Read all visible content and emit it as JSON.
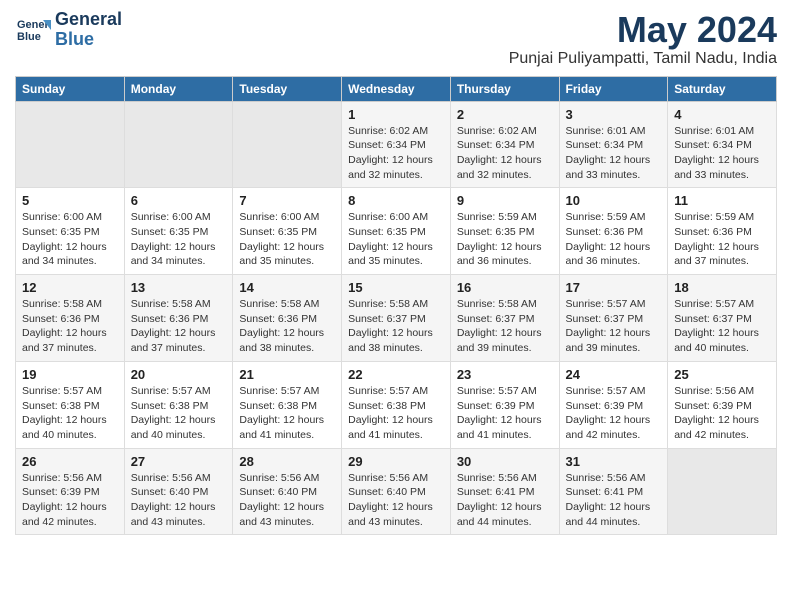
{
  "header": {
    "logo_line1": "General",
    "logo_line2": "Blue",
    "title": "May 2024",
    "subtitle": "Punjai Puliyampatti, Tamil Nadu, India"
  },
  "weekdays": [
    "Sunday",
    "Monday",
    "Tuesday",
    "Wednesday",
    "Thursday",
    "Friday",
    "Saturday"
  ],
  "weeks": [
    [
      {
        "day": "",
        "empty": true
      },
      {
        "day": "",
        "empty": true
      },
      {
        "day": "",
        "empty": true
      },
      {
        "day": "1",
        "sunrise": "6:02 AM",
        "sunset": "6:34 PM",
        "daylight": "12 hours and 32 minutes."
      },
      {
        "day": "2",
        "sunrise": "6:02 AM",
        "sunset": "6:34 PM",
        "daylight": "12 hours and 32 minutes."
      },
      {
        "day": "3",
        "sunrise": "6:01 AM",
        "sunset": "6:34 PM",
        "daylight": "12 hours and 33 minutes."
      },
      {
        "day": "4",
        "sunrise": "6:01 AM",
        "sunset": "6:34 PM",
        "daylight": "12 hours and 33 minutes."
      }
    ],
    [
      {
        "day": "5",
        "sunrise": "6:00 AM",
        "sunset": "6:35 PM",
        "daylight": "12 hours and 34 minutes."
      },
      {
        "day": "6",
        "sunrise": "6:00 AM",
        "sunset": "6:35 PM",
        "daylight": "12 hours and 34 minutes."
      },
      {
        "day": "7",
        "sunrise": "6:00 AM",
        "sunset": "6:35 PM",
        "daylight": "12 hours and 35 minutes."
      },
      {
        "day": "8",
        "sunrise": "6:00 AM",
        "sunset": "6:35 PM",
        "daylight": "12 hours and 35 minutes."
      },
      {
        "day": "9",
        "sunrise": "5:59 AM",
        "sunset": "6:35 PM",
        "daylight": "12 hours and 36 minutes."
      },
      {
        "day": "10",
        "sunrise": "5:59 AM",
        "sunset": "6:36 PM",
        "daylight": "12 hours and 36 minutes."
      },
      {
        "day": "11",
        "sunrise": "5:59 AM",
        "sunset": "6:36 PM",
        "daylight": "12 hours and 37 minutes."
      }
    ],
    [
      {
        "day": "12",
        "sunrise": "5:58 AM",
        "sunset": "6:36 PM",
        "daylight": "12 hours and 37 minutes."
      },
      {
        "day": "13",
        "sunrise": "5:58 AM",
        "sunset": "6:36 PM",
        "daylight": "12 hours and 37 minutes."
      },
      {
        "day": "14",
        "sunrise": "5:58 AM",
        "sunset": "6:36 PM",
        "daylight": "12 hours and 38 minutes."
      },
      {
        "day": "15",
        "sunrise": "5:58 AM",
        "sunset": "6:37 PM",
        "daylight": "12 hours and 38 minutes."
      },
      {
        "day": "16",
        "sunrise": "5:58 AM",
        "sunset": "6:37 PM",
        "daylight": "12 hours and 39 minutes."
      },
      {
        "day": "17",
        "sunrise": "5:57 AM",
        "sunset": "6:37 PM",
        "daylight": "12 hours and 39 minutes."
      },
      {
        "day": "18",
        "sunrise": "5:57 AM",
        "sunset": "6:37 PM",
        "daylight": "12 hours and 40 minutes."
      }
    ],
    [
      {
        "day": "19",
        "sunrise": "5:57 AM",
        "sunset": "6:38 PM",
        "daylight": "12 hours and 40 minutes."
      },
      {
        "day": "20",
        "sunrise": "5:57 AM",
        "sunset": "6:38 PM",
        "daylight": "12 hours and 40 minutes."
      },
      {
        "day": "21",
        "sunrise": "5:57 AM",
        "sunset": "6:38 PM",
        "daylight": "12 hours and 41 minutes."
      },
      {
        "day": "22",
        "sunrise": "5:57 AM",
        "sunset": "6:38 PM",
        "daylight": "12 hours and 41 minutes."
      },
      {
        "day": "23",
        "sunrise": "5:57 AM",
        "sunset": "6:39 PM",
        "daylight": "12 hours and 41 minutes."
      },
      {
        "day": "24",
        "sunrise": "5:57 AM",
        "sunset": "6:39 PM",
        "daylight": "12 hours and 42 minutes."
      },
      {
        "day": "25",
        "sunrise": "5:56 AM",
        "sunset": "6:39 PM",
        "daylight": "12 hours and 42 minutes."
      }
    ],
    [
      {
        "day": "26",
        "sunrise": "5:56 AM",
        "sunset": "6:39 PM",
        "daylight": "12 hours and 42 minutes."
      },
      {
        "day": "27",
        "sunrise": "5:56 AM",
        "sunset": "6:40 PM",
        "daylight": "12 hours and 43 minutes."
      },
      {
        "day": "28",
        "sunrise": "5:56 AM",
        "sunset": "6:40 PM",
        "daylight": "12 hours and 43 minutes."
      },
      {
        "day": "29",
        "sunrise": "5:56 AM",
        "sunset": "6:40 PM",
        "daylight": "12 hours and 43 minutes."
      },
      {
        "day": "30",
        "sunrise": "5:56 AM",
        "sunset": "6:41 PM",
        "daylight": "12 hours and 44 minutes."
      },
      {
        "day": "31",
        "sunrise": "5:56 AM",
        "sunset": "6:41 PM",
        "daylight": "12 hours and 44 minutes."
      },
      {
        "day": "",
        "empty": true
      }
    ]
  ],
  "labels": {
    "sunrise": "Sunrise:",
    "sunset": "Sunset:",
    "daylight": "Daylight:"
  }
}
